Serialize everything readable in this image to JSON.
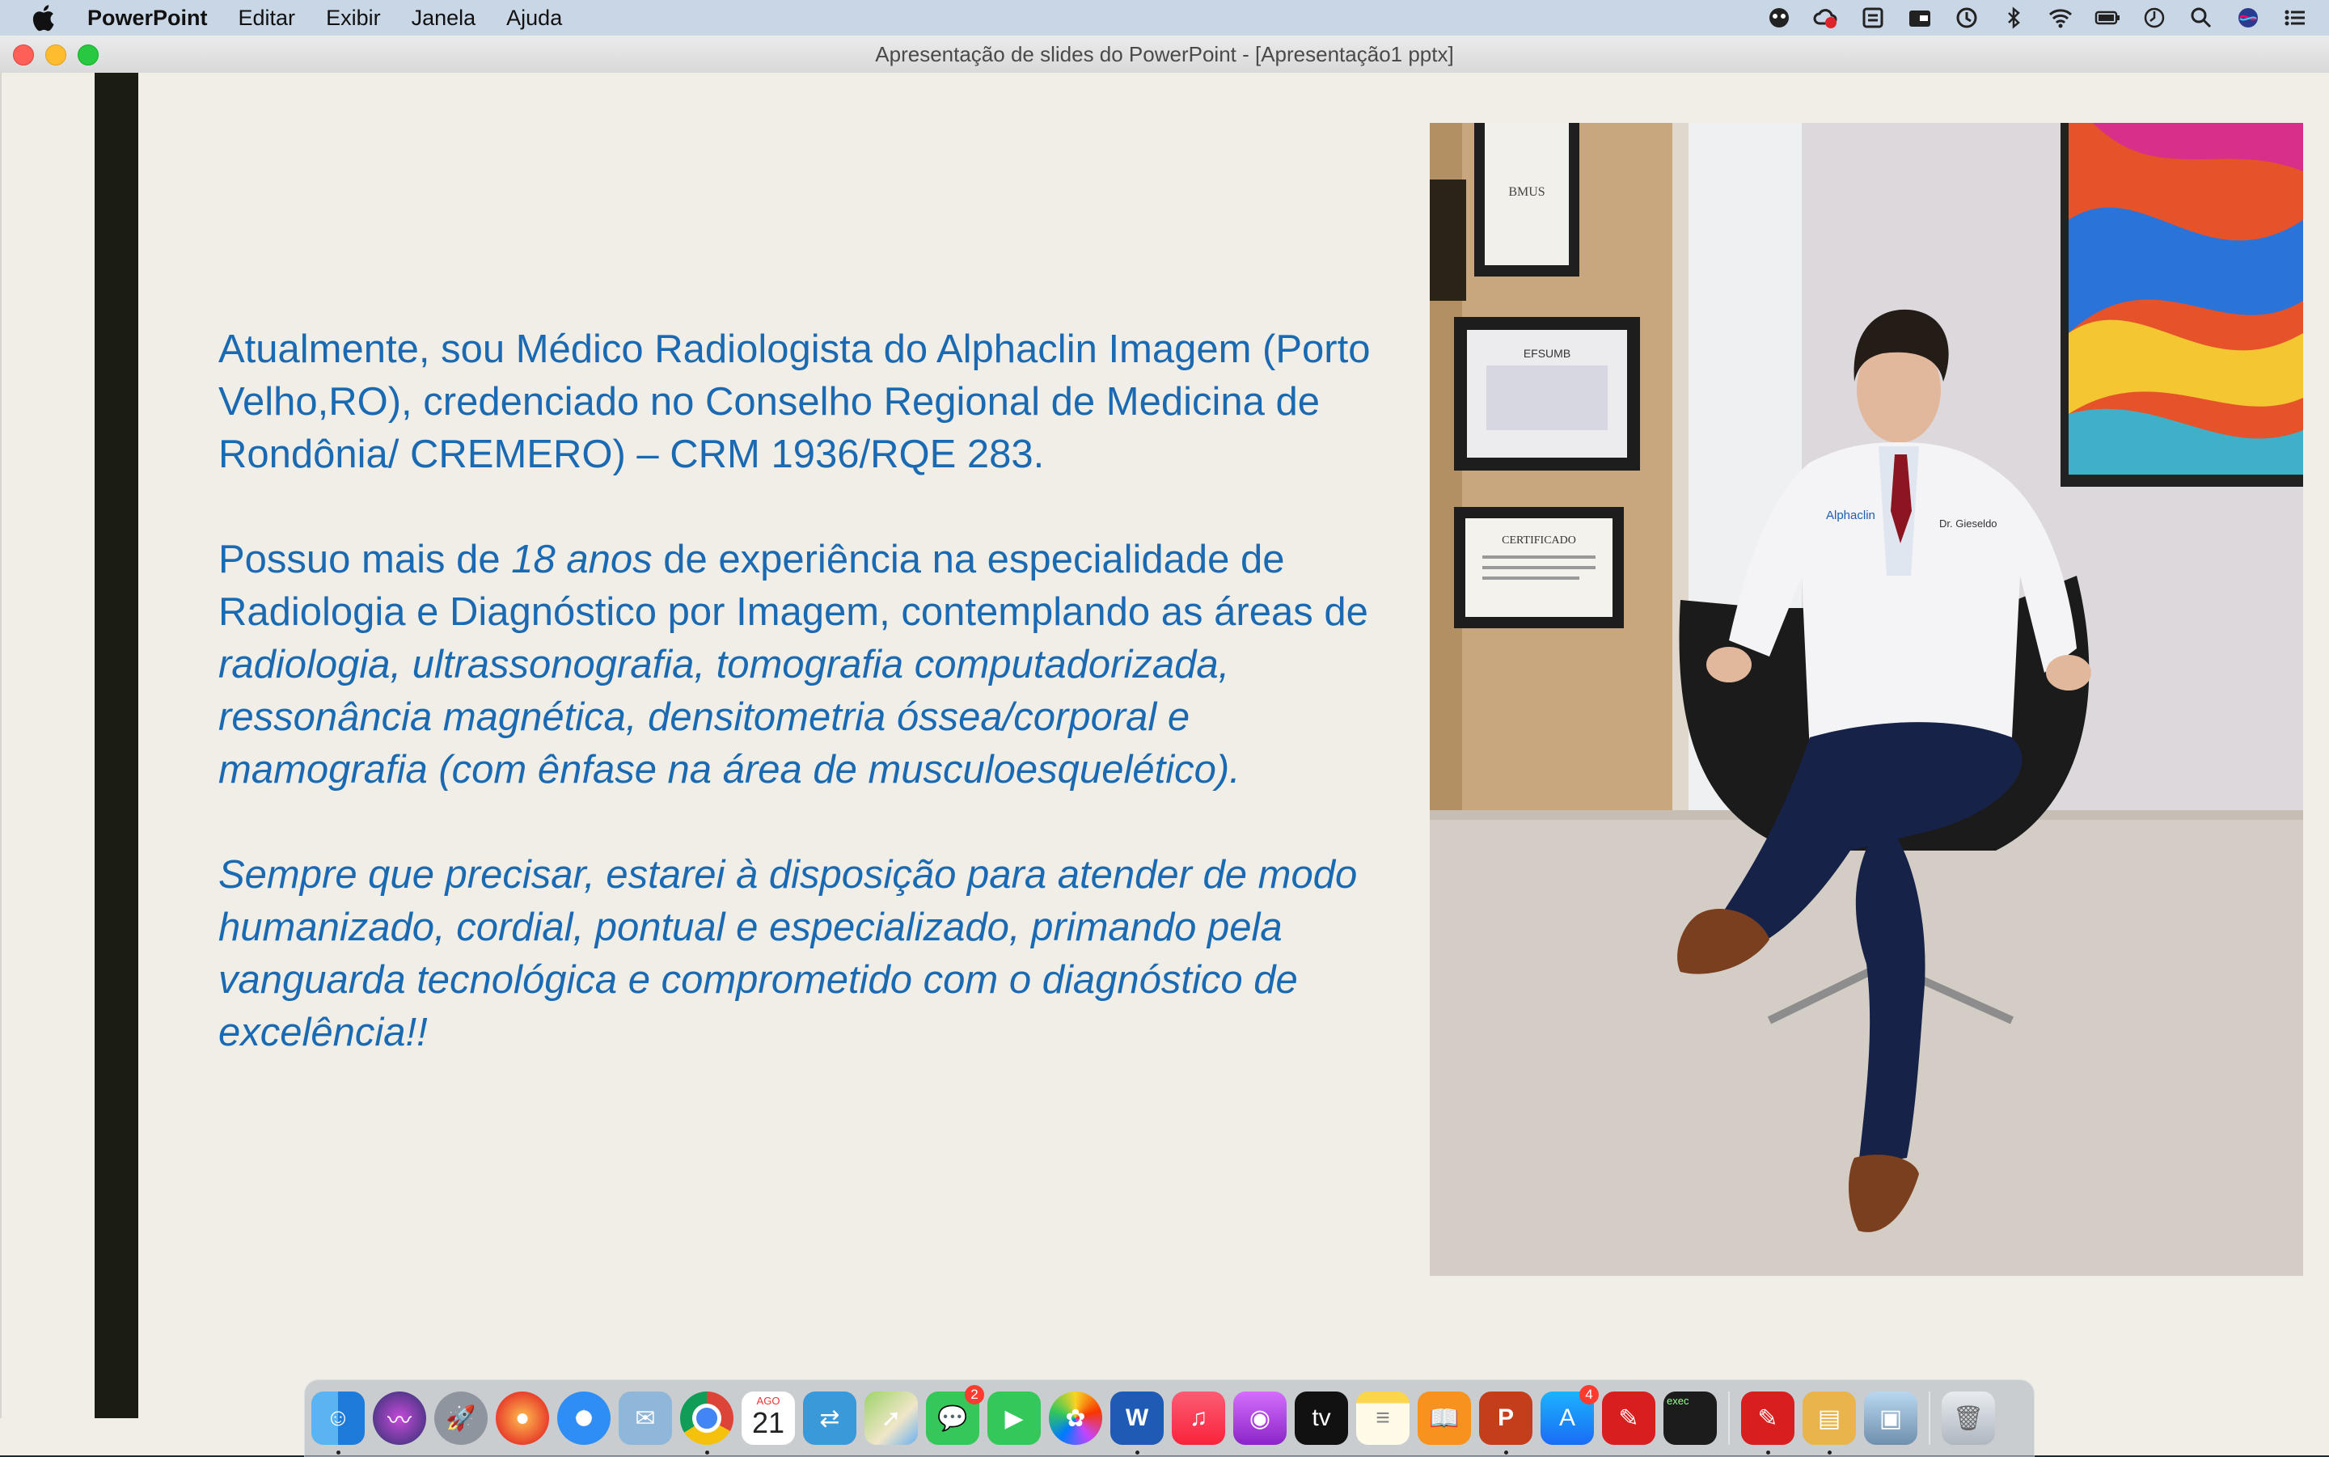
{
  "menubar": {
    "app_name": "PowerPoint",
    "menus": [
      "Editar",
      "Exibir",
      "Janela",
      "Ajuda"
    ],
    "status_icons": [
      "face-icon",
      "cloud-record-icon",
      "sync-icon",
      "wallet-icon",
      "time-machine-icon",
      "bluetooth-icon",
      "wifi-icon",
      "battery-icon",
      "clock-icon",
      "search-icon",
      "siri-icon",
      "control-center-icon"
    ]
  },
  "window": {
    "title": "Apresentação de slides do PowerPoint - [Apresentação1 pptx]"
  },
  "slide": {
    "paragraph1": "Atualmente, sou Médico Radiologista do Alphaclin Imagem (Porto Velho,RO), credenciado no Conselho Regional de Medicina de Rondônia/ CREMERO) – CRM 1936/RQE 283.",
    "p2_part1": "Possuo mais de ",
    "p2_italic1": "18 anos",
    "p2_part2": " de experiência na especialidade de Radiologia e Diagnóstico por Imagem, contemplando as áreas de ",
    "p2_italic2": "radiologia, ultrassonografia, tomografia computadorizada, ressonância magnética, densitometria óssea/corporal e mamografia (com ênfase na área de musculoesquelético).",
    "paragraph3": "Sempre que precisar, estarei à disposição para atender de modo humanizado, cordial, pontual e especializado, primando pela vanguarda tecnológica e comprometido com o diagnóstico de excelência!!",
    "photo": {
      "certificate1_text": "BMUS",
      "certificate2_text": "EFSUMB",
      "certificate3_text": "CERTIFICADO",
      "coat_logo": "Alphaclin",
      "coat_name": "Dr. Gieseldo"
    }
  },
  "dock": {
    "apps": [
      "finder",
      "siri",
      "launchpad",
      "firefox",
      "safari",
      "mail",
      "chrome",
      "calendar",
      "migration",
      "maps",
      "messages",
      "facetime",
      "photos",
      "word",
      "music",
      "podcasts",
      "apple-tv",
      "notes",
      "books",
      "powerpoint",
      "app-store",
      "acrobat",
      "terminal"
    ],
    "calendar_month": "AGO",
    "calendar_day": "21",
    "messages_badge": "2",
    "appstore_badge": "4",
    "terminal_label": "exec"
  },
  "colors": {
    "slide_text": "#1a6ab3",
    "slide_background": "#f0eee6",
    "slide_bar": "#1b1d15",
    "menubar": "#c9d6e6"
  }
}
